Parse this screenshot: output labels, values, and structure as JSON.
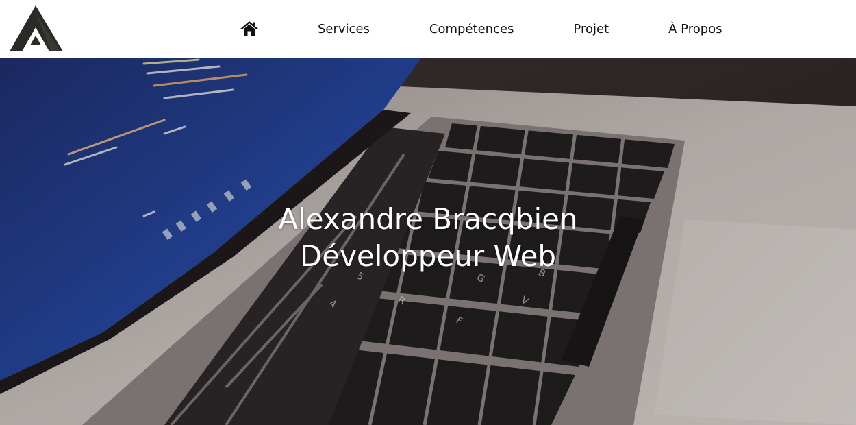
{
  "colors": {
    "header_bg": "#ffffff",
    "nav_text": "#111111",
    "hero_text": "#ffffff",
    "logo_dark": "#2b2a27",
    "laptop_silver": "#c9c2be",
    "screen_blue": "#1e3d91"
  },
  "logo": {
    "icon": "triangle-a-logo"
  },
  "nav": {
    "home_icon": "home-icon",
    "items": [
      {
        "label": "Services"
      },
      {
        "label": "Compétences"
      },
      {
        "label": "Projet"
      },
      {
        "label": "À Propos"
      }
    ]
  },
  "hero": {
    "background": "laptop-keyboard-photo",
    "name": "Alexandre Bracqbien",
    "role": "Développeur Web"
  }
}
